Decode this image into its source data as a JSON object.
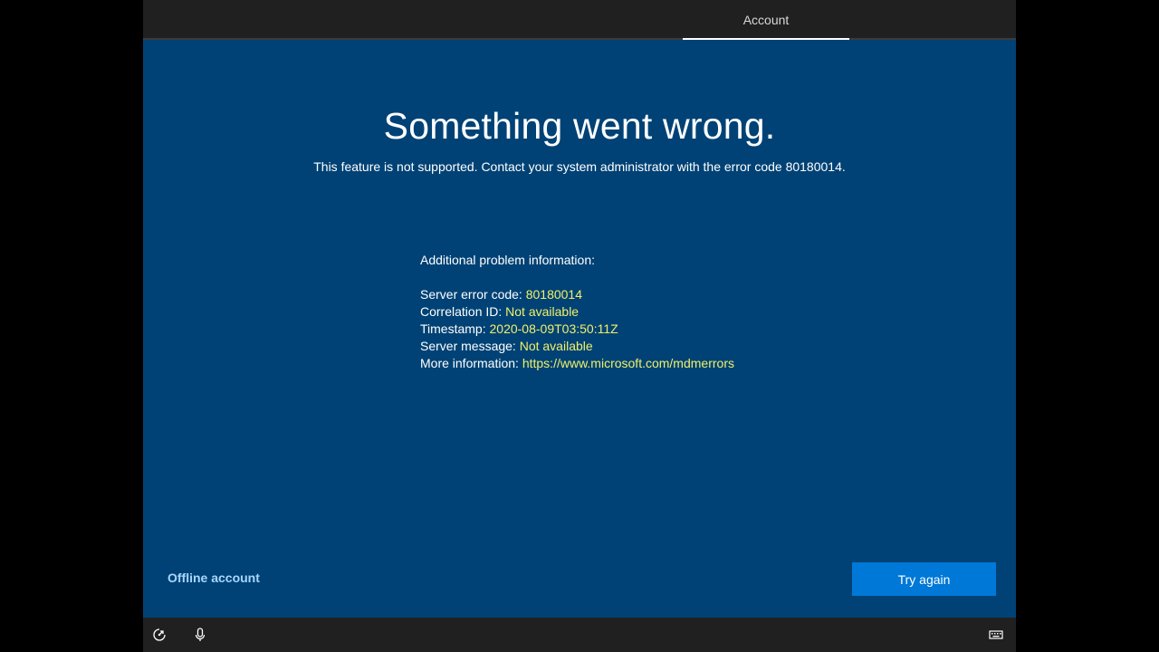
{
  "header": {
    "active_tab": "Account"
  },
  "main": {
    "title": "Something went wrong.",
    "message": "This feature is not supported. Contact your system administrator with the error code 80180014."
  },
  "problem_info": {
    "title": "Additional problem information:",
    "rows": [
      {
        "label": "Server error code: ",
        "value": "80180014"
      },
      {
        "label": "Correlation ID: ",
        "value": "Not available"
      },
      {
        "label": "Timestamp: ",
        "value": "2020-08-09T03:50:11Z"
      },
      {
        "label": "Server message: ",
        "value": "Not available"
      },
      {
        "label": "More information: ",
        "value": "https://www.microsoft.com/mdmerrors"
      }
    ]
  },
  "footer": {
    "offline_link": "Offline account",
    "try_again_button": "Try again"
  },
  "bottom_bar": {
    "icons": [
      "ease-of-access-icon",
      "microphone-icon",
      "keyboard-icon"
    ]
  },
  "colors": {
    "background": "#004275",
    "accent_button": "#0078d7",
    "value_text": "#f0f06a",
    "link_text": "#a6d8ff"
  }
}
